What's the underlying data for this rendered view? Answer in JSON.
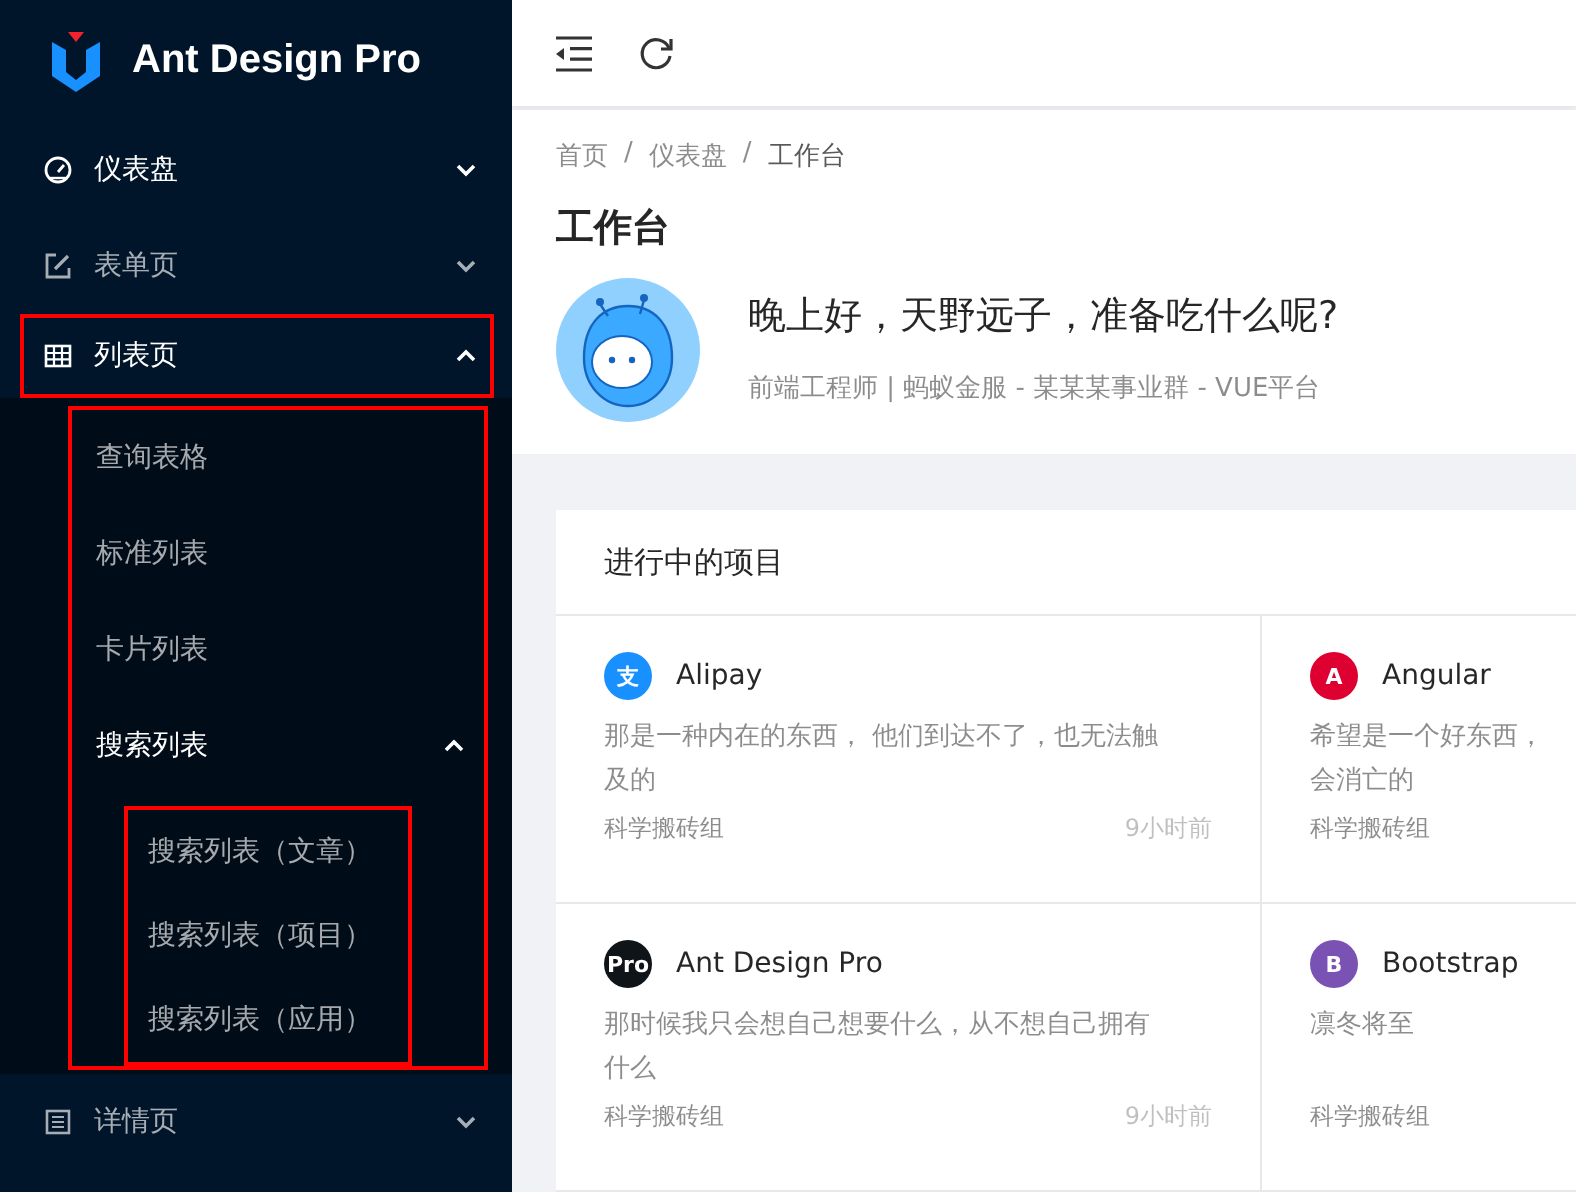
{
  "sidebar": {
    "logo_text": "Ant Design Pro",
    "items": [
      {
        "label": "仪表盘",
        "active": true,
        "expanded": false,
        "framed": false
      },
      {
        "label": "表单页",
        "active": false,
        "expanded": false,
        "framed": false
      },
      {
        "label": "列表页",
        "active": true,
        "expanded": true,
        "framed": true,
        "children_framed": true,
        "children": [
          {
            "label": "查询表格",
            "active": false
          },
          {
            "label": "标准列表",
            "active": false
          },
          {
            "label": "卡片列表",
            "active": false
          },
          {
            "label": "搜索列表",
            "active": true,
            "expanded": true,
            "children_framed": true,
            "children": [
              {
                "label": "搜索列表（文章）",
                "active": false
              },
              {
                "label": "搜索列表（项目）",
                "active": false
              },
              {
                "label": "搜索列表（应用）",
                "active": false
              }
            ]
          }
        ]
      },
      {
        "label": "详情页",
        "active": false,
        "expanded": false,
        "framed": false
      }
    ]
  },
  "breadcrumb": [
    {
      "label": "首页",
      "separator": "/"
    },
    {
      "label": "仪表盘",
      "separator": "/"
    },
    {
      "label": "工作台"
    }
  ],
  "page_title": "工作台",
  "greeting": "晚上好，天野远子，准备吃什么呢?",
  "profile_line": "前端工程师 | 蚂蚁金服 - 某某某事业群 - VUE平台",
  "projects": {
    "title": "进行中的项目",
    "items": [
      {
        "name": "Alipay",
        "logo_text": "支",
        "color": "#1890ff",
        "description": [
          "那是一种内在的东西， 他们到达不了，也无法触",
          "及的"
        ],
        "group": "科学搬砖组",
        "time": "9小时前"
      },
      {
        "name": "Angular",
        "logo_text": "A",
        "color": "#dd0031",
        "description": [
          "希望是一个好东西，",
          "会消亡的"
        ],
        "group": "科学搬砖组"
      },
      {
        "name": "Ant Design Pro",
        "logo_text": "Pro",
        "color": "#0f1419",
        "description": [
          "那时候我只会想自己想要什么，从不想自己拥有",
          "什么"
        ],
        "group": "科学搬砖组",
        "time": "9小时前"
      },
      {
        "name": "Bootstrap",
        "logo_text": "B",
        "color": "#7952b3",
        "description": [
          "凛冬将至"
        ],
        "group": "科学搬砖组"
      }
    ]
  }
}
